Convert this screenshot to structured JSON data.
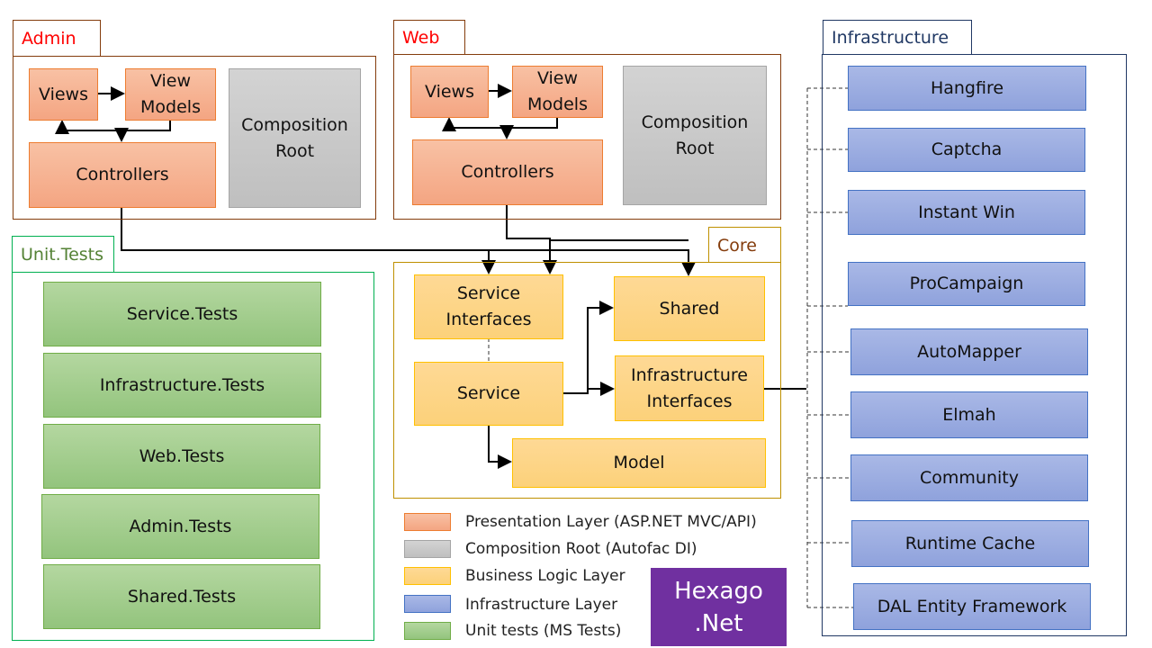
{
  "admin": {
    "title": "Admin",
    "views": "Views",
    "view_models": "View Models",
    "controllers": "Controllers",
    "composition_root": "Composition Root"
  },
  "web": {
    "title": "Web",
    "views": "Views",
    "view_models": "View Models",
    "controllers": "Controllers",
    "composition_root": "Composition Root"
  },
  "unit_tests": {
    "title": "Unit.Tests",
    "items": [
      "Service.Tests",
      "Infrastructure.Tests",
      "Web.Tests",
      "Admin.Tests",
      "Shared.Tests"
    ]
  },
  "core": {
    "title": "Core",
    "service_interfaces": "Service Interfaces",
    "shared": "Shared",
    "service": "Service",
    "infrastructure_interfaces": "Infrastructure Interfaces",
    "model": "Model"
  },
  "infrastructure": {
    "title": "Infrastructure",
    "items": [
      "Hangfire",
      "Captcha",
      "Instant Win",
      "ProCampaign",
      "AutoMapper",
      "Elmah",
      "Community",
      "Runtime Cache",
      "DAL Entity Framework"
    ]
  },
  "legend": [
    {
      "label": "Presentation Layer (ASP.NET MVC/API)",
      "color": "#f4a582"
    },
    {
      "label": "Composition Root (Autofac DI)",
      "color": "#c8c8c8"
    },
    {
      "label": "Business Logic Layer",
      "color": "#fcd17a"
    },
    {
      "label": "Infrastructure Layer",
      "color": "#8fa2dc"
    },
    {
      "label": "Unit tests (MS Tests)",
      "color": "#93c47d"
    }
  ],
  "logo": {
    "text": "Hexago .Net",
    "color": "#7030a0"
  }
}
